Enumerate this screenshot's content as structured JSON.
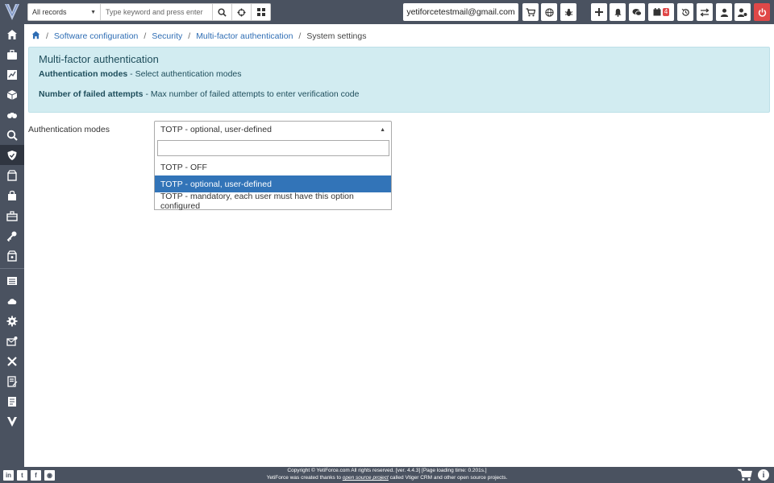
{
  "topbar": {
    "module_select": "All records",
    "search_placeholder": "Type keyword and press enter",
    "email": "yetiforcetestmail@gmail.com",
    "calendar_badge": "4"
  },
  "breadcrumb": {
    "item1": "Software configuration",
    "item2": "Security",
    "item3": "Multi-factor authentication",
    "current": "System settings"
  },
  "info": {
    "title": "Multi-factor authentication",
    "row1_bold": "Authentication modes",
    "row1_text": " - Select authentication modes",
    "row2_bold": "Number of failed attempts",
    "row2_text": " - Max number of failed attempts to enter verification code"
  },
  "form": {
    "label": "Authentication modes",
    "selected": "TOTP - optional, user-defined",
    "options": [
      "TOTP - OFF",
      "TOTP - optional, user-defined",
      "TOTP - mandatory, each user must have this option configured"
    ]
  },
  "footer": {
    "line1": "Copyright © YetiForce.com All rights reserved. [ver. 4.4.3] [Page loading time: 0.201s.]",
    "line2_a": "YetiForce was created thanks to ",
    "line2_link": "open source project",
    "line2_b": " called Vtiger CRM and other open source projects."
  },
  "colors": {
    "chrome": "#4a5260",
    "info_bg": "#d2ecf1",
    "selected_option": "#3274b8",
    "link": "#2e6db4",
    "power": "#e04848"
  }
}
